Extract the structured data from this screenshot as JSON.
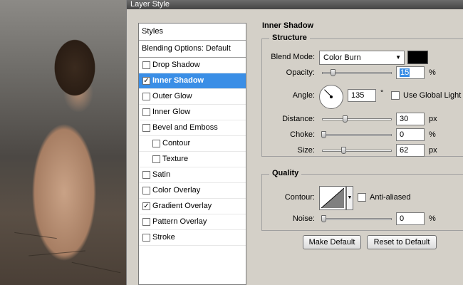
{
  "window": {
    "title": "Layer Style"
  },
  "sidebar": {
    "header": "Styles",
    "blending": "Blending Options: Default",
    "items": [
      {
        "label": "Drop Shadow",
        "checked": false
      },
      {
        "label": "Inner Shadow",
        "checked": true,
        "selected": true
      },
      {
        "label": "Outer Glow",
        "checked": false
      },
      {
        "label": "Inner Glow",
        "checked": false
      },
      {
        "label": "Bevel and Emboss",
        "checked": false
      },
      {
        "label": "Contour",
        "checked": false,
        "sub": true
      },
      {
        "label": "Texture",
        "checked": false,
        "sub": true
      },
      {
        "label": "Satin",
        "checked": false
      },
      {
        "label": "Color Overlay",
        "checked": false
      },
      {
        "label": "Gradient Overlay",
        "checked": true
      },
      {
        "label": "Pattern Overlay",
        "checked": false
      },
      {
        "label": "Stroke",
        "checked": false
      }
    ]
  },
  "panel": {
    "title": "Inner Shadow",
    "structure": {
      "title": "Structure",
      "blend_mode_label": "Blend Mode:",
      "blend_mode": "Color Burn",
      "blend_color": "#000000",
      "opacity_label": "Opacity:",
      "opacity": "15",
      "opacity_unit": "%",
      "opacity_fraction": 0.15,
      "angle_label": "Angle:",
      "angle": "135",
      "angle_unit": "°",
      "global_light_label": "Use Global Light",
      "global_light": false,
      "distance_label": "Distance:",
      "distance": "30",
      "distance_unit": "px",
      "choke_label": "Choke:",
      "choke": "0",
      "choke_unit": "%",
      "size_label": "Size:",
      "size": "62",
      "size_unit": "px"
    },
    "quality": {
      "title": "Quality",
      "contour_label": "Contour:",
      "antialiased_label": "Anti-aliased",
      "antialiased": false,
      "noise_label": "Noise:",
      "noise": "0",
      "noise_unit": "%"
    },
    "buttons": {
      "make_default": "Make Default",
      "reset_default": "Reset to Default"
    }
  },
  "colors": {
    "selection": "#3a8ee6",
    "dialog_bg": "#d4d0c8"
  }
}
